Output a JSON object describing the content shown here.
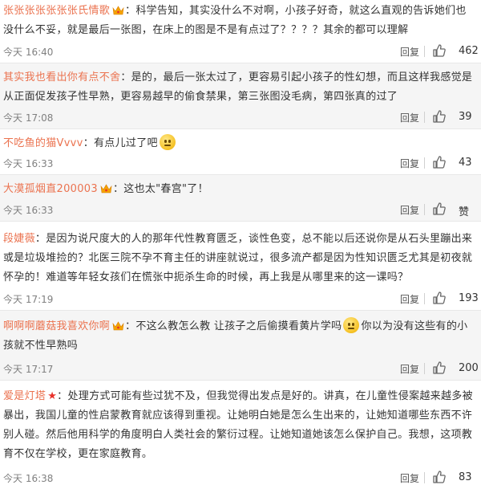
{
  "comments": [
    {
      "user": "张张张张张张张氏情歌",
      "badge": "crown",
      "after": "",
      "text": "：科学告知，其实没什么不对啊，小孩子好奇，就这么直观的告诉她们也没什么不妥，就是最后一张图，在床上的图是不是有点过了？？？？其余的都可以理解",
      "time": "今天 16:40",
      "reply": "回复",
      "likes": "462"
    },
    {
      "user": "其实我也看出你有点不舍",
      "badge": "",
      "after": "",
      "text": "：是的，最后一张太过了，更容易引起小孩子的性幻想，而且这样我感觉是从正面促发孩子性早熟，更容易越早的偷食禁果，第三张图没毛病，第四张真的过了",
      "time": "今天 17:08",
      "reply": "回复",
      "likes": "39"
    },
    {
      "user": "不吃鱼的猫Vvvv",
      "badge": "",
      "after": "",
      "text": "：有点儿过了吧",
      "time": "今天 16:33",
      "reply": "回复",
      "likes": "43"
    },
    {
      "user": "大漠孤烟直200003",
      "badge": "crown",
      "after": "",
      "text": "：这也太\"春宫\"了！",
      "time": "今天 16:33",
      "reply": "回复",
      "likes": "赞"
    },
    {
      "user": "段婕薇",
      "badge": "",
      "after": "",
      "text": "：是因为说尺度大的人的那年代性教育匮乏，谈性色变，总不能以后还说你是从石头里蹦出来或是垃圾堆捡的？北医三院不孕不育主任的讲座就说过，很多流产都是因为性知识匮乏尤其是初夜就怀孕的！难道等年轻女孩们在慌张中扼杀生命的时候，再上我是从哪里来的这一课吗？",
      "time": "今天 17:19",
      "reply": "回复",
      "likes": "193"
    },
    {
      "user": "啊啊啊蘑菇我喜欢你啊",
      "badge": "crown",
      "after": "你以为没有这些有的小孩就不性早熟吗",
      "text": "：不这么教怎么教 让孩子之后偷摸看黄片学吗",
      "time": "今天 17:17",
      "reply": "回复",
      "likes": "200"
    },
    {
      "user": "爱是灯塔",
      "badge": "star",
      "after": "",
      "text": "：处理方式可能有些过犹不及，但我觉得出发点是好的。讲真，在儿童性侵案越来越多被暴出，我国儿童的性启蒙教育就应该得到重视。让她明白她是怎么生出来的，让她知道哪些东西不许别人碰。然后他用科学的角度明白人类社会的繁衍过程。让她知道她该怎么保护自己。我想，这项教育不仅在学校，更在家庭教育。",
      "time": "今天 16:38",
      "reply": "回复",
      "likes": "83"
    }
  ]
}
